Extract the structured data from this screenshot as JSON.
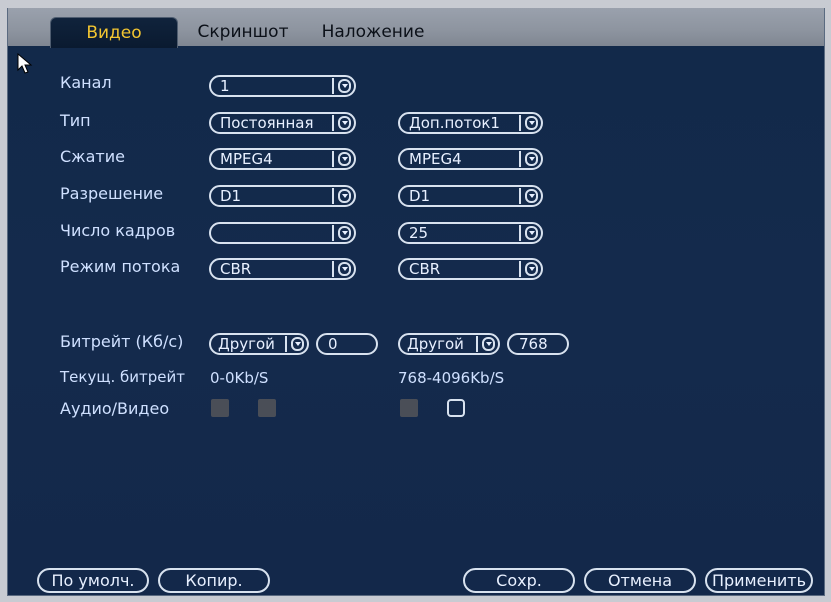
{
  "tabs": [
    {
      "label": "Видео",
      "active": true
    },
    {
      "label": "Скриншот",
      "active": false
    },
    {
      "label": "Наложение",
      "active": false
    }
  ],
  "rows": {
    "channel": {
      "label": "Канал",
      "main": "1"
    },
    "type": {
      "label": "Тип",
      "main": "Постоянная",
      "extra": "Доп.поток1"
    },
    "compression": {
      "label": "Сжатие",
      "main": "MPEG4",
      "extra": "MPEG4"
    },
    "resolution": {
      "label": "Разрешение",
      "main": "D1",
      "extra": "D1"
    },
    "framerate": {
      "label": "Число кадров",
      "main": "",
      "extra": "25"
    },
    "stream_mode": {
      "label": "Режим потока",
      "main": "CBR",
      "extra": "CBR"
    },
    "bitrate": {
      "label": "Битрейт (Кб/с)",
      "main_mode": "Другой",
      "main_value": "0",
      "extra_mode": "Другой",
      "extra_value": "768"
    },
    "current_bitrate": {
      "label": "Текущ. битрейт",
      "main": "0-0Kb/S",
      "extra": "768-4096Kb/S"
    },
    "audio_video": {
      "label": "Аудио/Видео",
      "main_audio": false,
      "main_video": false,
      "extra_audio": false,
      "extra_video": true
    }
  },
  "buttons": {
    "default": "По умолч.",
    "copy": "Копир.",
    "save": "Сохр.",
    "cancel": "Отмена",
    "apply": "Применить"
  },
  "colors": {
    "active_tab_text": "#f2c531",
    "panel_bg": "#13284a",
    "control_border": "#d8e2ef"
  },
  "icons": {
    "cursor": "mouse-pointer-icon",
    "dropdown": "chevron-down-icon"
  }
}
